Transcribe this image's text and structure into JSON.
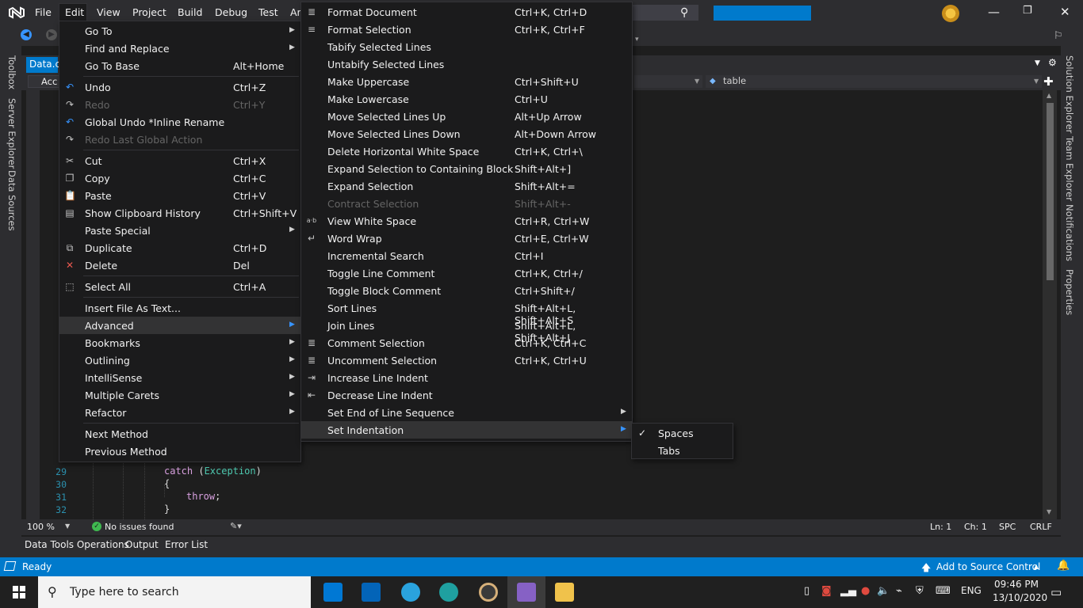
{
  "menubar": {
    "items": [
      "File",
      "Edit",
      "View",
      "Project",
      "Build",
      "Debug",
      "Test",
      "Ar"
    ]
  },
  "document": {
    "tab": "Data.cs",
    "nav_left": "Acc",
    "nav_right": "table"
  },
  "side_tabs_left": [
    "Toolbox",
    "Server Explorer",
    "Data Sources"
  ],
  "side_tabs_right": [
    "Solution Explorer",
    "Team Explorer",
    "Notifications",
    "Properties"
  ],
  "code": {
    "lines": [
      {
        "num": "29",
        "text_kw": "catch",
        "text_mid": " (",
        "text_ty": "Exception",
        "text_end": ")"
      },
      {
        "num": "30",
        "text": "{"
      },
      {
        "num": "31",
        "text_kw": "throw",
        "text_end": ";"
      },
      {
        "num": "32",
        "text": "}"
      }
    ]
  },
  "editor_status": {
    "zoom": "100 %",
    "issues": "No issues found",
    "ln": "Ln: 1",
    "ch": "Ch: 1",
    "spc": "SPC",
    "crlf": "CRLF"
  },
  "bottom_tabs": [
    "Data Tools Operations",
    "Output",
    "Error List"
  ],
  "statusbar": {
    "ready": "Ready",
    "source_control": "Add to Source Control"
  },
  "taskbar": {
    "search_placeholder": "Type here to search",
    "lang": "ENG",
    "time": "09:46 PM",
    "date": "13/10/2020"
  },
  "edit_menu": [
    {
      "label": "Go To",
      "shortcut": "",
      "submenu": true
    },
    {
      "label": "Find and Replace",
      "shortcut": "",
      "submenu": true
    },
    {
      "label": "Go To Base",
      "shortcut": "Alt+Home"
    },
    {
      "sep": true
    },
    {
      "label": "Undo",
      "shortcut": "Ctrl+Z",
      "icon": "undo-icon"
    },
    {
      "label": "Redo",
      "shortcut": "Ctrl+Y",
      "icon": "redo-icon",
      "disabled": true
    },
    {
      "label": "Global Undo *Inline Rename",
      "shortcut": "",
      "icon": "undo-icon"
    },
    {
      "label": "Redo Last Global Action",
      "shortcut": "",
      "icon": "redo-icon",
      "disabled": true
    },
    {
      "sep": true
    },
    {
      "label": "Cut",
      "shortcut": "Ctrl+X",
      "icon": "scissors-icon"
    },
    {
      "label": "Copy",
      "shortcut": "Ctrl+C",
      "icon": "copy-icon"
    },
    {
      "label": "Paste",
      "shortcut": "Ctrl+V",
      "icon": "paste-icon"
    },
    {
      "label": "Show Clipboard History",
      "shortcut": "Ctrl+Shift+V",
      "icon": "clipboard-history-icon"
    },
    {
      "label": "Paste Special",
      "shortcut": "",
      "submenu": true
    },
    {
      "label": "Duplicate",
      "shortcut": "Ctrl+D",
      "icon": "duplicate-icon"
    },
    {
      "label": "Delete",
      "shortcut": "Del",
      "icon": "delete-icon"
    },
    {
      "sep": true
    },
    {
      "label": "Select All",
      "shortcut": "Ctrl+A",
      "icon": "select-all-icon"
    },
    {
      "sep": true
    },
    {
      "label": "Insert File As Text...",
      "shortcut": ""
    },
    {
      "label": "Advanced",
      "shortcut": "",
      "submenu": true,
      "highlight": true
    },
    {
      "label": "Bookmarks",
      "shortcut": "",
      "submenu": true
    },
    {
      "label": "Outlining",
      "shortcut": "",
      "submenu": true
    },
    {
      "label": "IntelliSense",
      "shortcut": "",
      "submenu": true
    },
    {
      "label": "Multiple Carets",
      "shortcut": "",
      "submenu": true
    },
    {
      "label": "Refactor",
      "shortcut": "",
      "submenu": true
    },
    {
      "sep": true
    },
    {
      "label": "Next Method",
      "shortcut": ""
    },
    {
      "label": "Previous Method",
      "shortcut": ""
    }
  ],
  "advanced_menu": [
    {
      "label": "Format Document",
      "shortcut": "Ctrl+K, Ctrl+D",
      "icon": "format-document-icon"
    },
    {
      "label": "Format Selection",
      "shortcut": "Ctrl+K, Ctrl+F",
      "icon": "format-selection-icon"
    },
    {
      "label": "Tabify Selected Lines",
      "shortcut": ""
    },
    {
      "label": "Untabify Selected Lines",
      "shortcut": ""
    },
    {
      "label": "Make Uppercase",
      "shortcut": "Ctrl+Shift+U"
    },
    {
      "label": "Make Lowercase",
      "shortcut": "Ctrl+U"
    },
    {
      "label": "Move Selected Lines Up",
      "shortcut": "Alt+Up Arrow"
    },
    {
      "label": "Move Selected Lines Down",
      "shortcut": "Alt+Down Arrow"
    },
    {
      "label": "Delete Horizontal White Space",
      "shortcut": "Ctrl+K, Ctrl+\\"
    },
    {
      "label": "Expand Selection to Containing Block",
      "shortcut": "Shift+Alt+]"
    },
    {
      "label": "Expand Selection",
      "shortcut": "Shift+Alt+="
    },
    {
      "label": "Contract Selection",
      "shortcut": "Shift+Alt+-",
      "disabled": true
    },
    {
      "label": "View White Space",
      "shortcut": "Ctrl+R, Ctrl+W",
      "icon": "white-space-icon"
    },
    {
      "label": "Word Wrap",
      "shortcut": "Ctrl+E, Ctrl+W",
      "icon": "word-wrap-icon"
    },
    {
      "label": "Incremental Search",
      "shortcut": "Ctrl+I"
    },
    {
      "label": "Toggle Line Comment",
      "shortcut": "Ctrl+K, Ctrl+/"
    },
    {
      "label": "Toggle Block Comment",
      "shortcut": "Ctrl+Shift+/"
    },
    {
      "label": "Sort Lines",
      "shortcut": "Shift+Alt+L, Shift+Alt+S"
    },
    {
      "label": "Join Lines",
      "shortcut": "Shift+Alt+L, Shift+Alt+J"
    },
    {
      "label": "Comment Selection",
      "shortcut": "Ctrl+K, Ctrl+C",
      "icon": "comment-icon"
    },
    {
      "label": "Uncomment Selection",
      "shortcut": "Ctrl+K, Ctrl+U",
      "icon": "uncomment-icon"
    },
    {
      "label": "Increase Line Indent",
      "shortcut": "",
      "icon": "indent-icon"
    },
    {
      "label": "Decrease Line Indent",
      "shortcut": "",
      "icon": "outdent-icon"
    },
    {
      "label": "Set End of Line Sequence",
      "shortcut": "",
      "submenu": true
    },
    {
      "label": "Set Indentation",
      "shortcut": "",
      "submenu": true,
      "highlight": true
    }
  ],
  "indent_menu": [
    {
      "label": "Spaces",
      "checked": true
    },
    {
      "label": "Tabs",
      "checked": false
    }
  ]
}
